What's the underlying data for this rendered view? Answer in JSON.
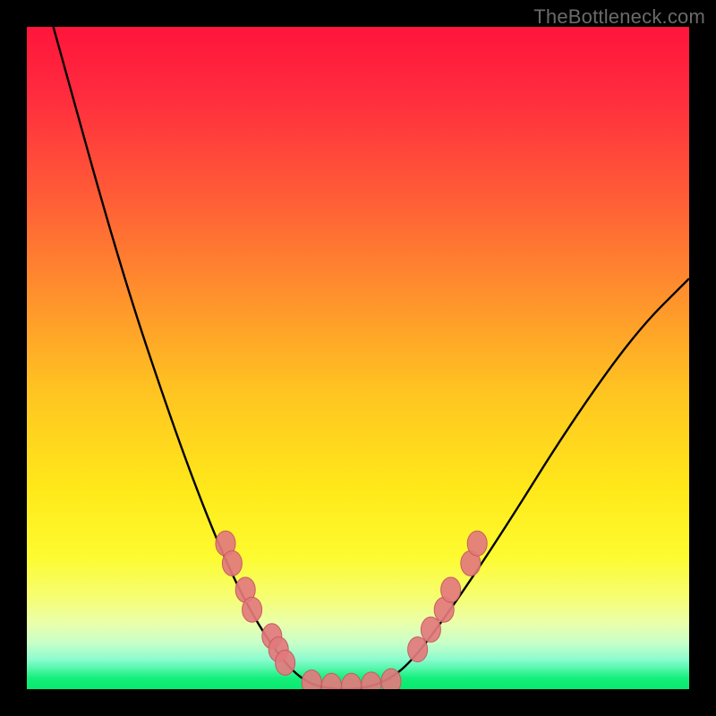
{
  "watermark": "TheBottleneck.com",
  "colors": {
    "black": "#000000",
    "curve": "#000000",
    "marker_fill": "#e27a7d",
    "marker_stroke": "#c75b5f",
    "green_band": "#14f07a"
  },
  "chart_data": {
    "type": "line",
    "title": "",
    "xlabel": "",
    "ylabel": "",
    "xlim": [
      0,
      100
    ],
    "ylim": [
      0,
      100
    ],
    "curve_points": [
      {
        "x": 4,
        "y": 100
      },
      {
        "x": 14,
        "y": 64
      },
      {
        "x": 22,
        "y": 40
      },
      {
        "x": 28,
        "y": 24
      },
      {
        "x": 33,
        "y": 13
      },
      {
        "x": 38,
        "y": 5
      },
      {
        "x": 42,
        "y": 1
      },
      {
        "x": 46,
        "y": 0
      },
      {
        "x": 50,
        "y": 0
      },
      {
        "x": 54,
        "y": 1
      },
      {
        "x": 58,
        "y": 4
      },
      {
        "x": 64,
        "y": 12
      },
      {
        "x": 72,
        "y": 24
      },
      {
        "x": 82,
        "y": 40
      },
      {
        "x": 92,
        "y": 54
      },
      {
        "x": 100,
        "y": 62
      }
    ],
    "series": [
      {
        "name": "left-cluster",
        "points": [
          {
            "x": 30,
            "y": 22
          },
          {
            "x": 31,
            "y": 19
          },
          {
            "x": 33,
            "y": 15
          },
          {
            "x": 34,
            "y": 12
          },
          {
            "x": 37,
            "y": 8
          },
          {
            "x": 38,
            "y": 6
          },
          {
            "x": 39,
            "y": 4
          }
        ]
      },
      {
        "name": "bottom-cluster",
        "points": [
          {
            "x": 43,
            "y": 1
          },
          {
            "x": 46,
            "y": 0.5
          },
          {
            "x": 49,
            "y": 0.5
          },
          {
            "x": 52,
            "y": 0.7
          },
          {
            "x": 55,
            "y": 1.2
          }
        ]
      },
      {
        "name": "right-cluster",
        "points": [
          {
            "x": 59,
            "y": 6
          },
          {
            "x": 61,
            "y": 9
          },
          {
            "x": 63,
            "y": 12
          },
          {
            "x": 64,
            "y": 15
          },
          {
            "x": 67,
            "y": 19
          },
          {
            "x": 68,
            "y": 22
          }
        ]
      }
    ],
    "annotations": []
  }
}
